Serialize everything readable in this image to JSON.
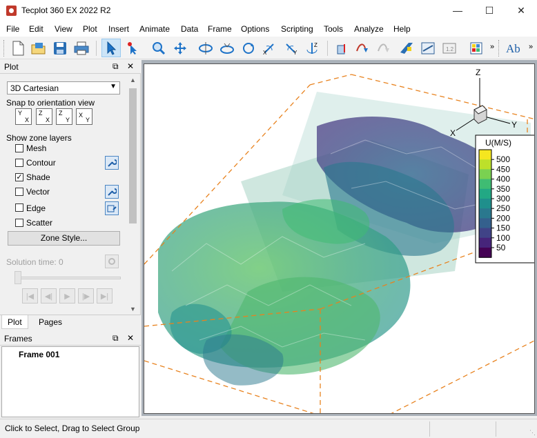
{
  "window": {
    "title": "Tecplot 360 EX 2022 R2"
  },
  "menu": [
    "File",
    "Edit",
    "View",
    "Plot",
    "Insert",
    "Animate",
    "Data",
    "Frame",
    "Options",
    "Scripting",
    "Tools",
    "Analyze",
    "Help"
  ],
  "plot_panel": {
    "title": "Plot",
    "plot_type": "3D Cartesian",
    "snap_label": "Snap to orientation view",
    "orient_buttons": [
      {
        "a": "Y",
        "b": "X"
      },
      {
        "a": "Z",
        "b": "X"
      },
      {
        "a": "Z",
        "b": "Y"
      },
      {
        "a": "X",
        "b": "Y"
      }
    ],
    "zone_layers_label": "Show zone layers",
    "layers": [
      {
        "label": "Mesh",
        "checked": false
      },
      {
        "label": "Contour",
        "checked": false
      },
      {
        "label": "Shade",
        "checked": true
      },
      {
        "label": "Vector",
        "checked": false
      },
      {
        "label": "Edge",
        "checked": false
      },
      {
        "label": "Scatter",
        "checked": false
      }
    ],
    "zone_style_button": "Zone Style...",
    "solution_time_label": "Solution time:",
    "solution_time_value": "0",
    "tabs": [
      "Plot",
      "Pages"
    ]
  },
  "frames_panel": {
    "title": "Frames",
    "items": [
      "Frame 001"
    ]
  },
  "legend": {
    "title": "U(M/S)",
    "levels": [
      "500",
      "450",
      "400",
      "350",
      "300",
      "250",
      "200",
      "150",
      "100",
      "50"
    ],
    "colors": [
      "#f5e61f",
      "#bde02a",
      "#7ad151",
      "#3fbc73",
      "#22a884",
      "#1f8f8c",
      "#2a788e",
      "#34608d",
      "#404387",
      "#46247a",
      "#440154"
    ]
  },
  "axes_triad": {
    "z": "Z",
    "y": "Y",
    "x": "X"
  },
  "status": {
    "message": "Click to Select, Drag to Select Group"
  },
  "colors": {
    "accent": "#0078d7",
    "bbox": "#e8821e"
  }
}
